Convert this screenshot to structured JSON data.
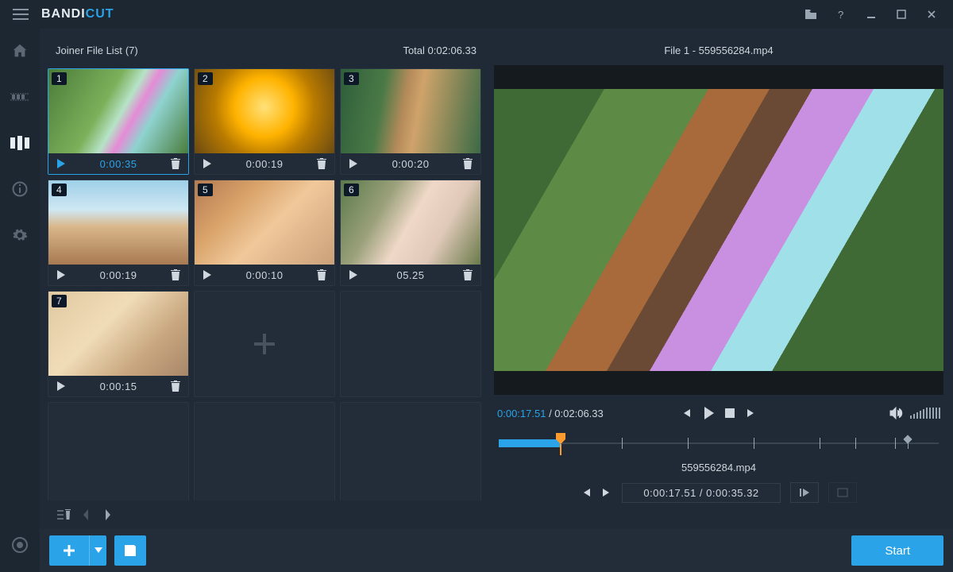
{
  "brand": {
    "bandi": "BANDI",
    "cut": "CUT"
  },
  "list": {
    "title": "Joiner File List",
    "count": "(7)",
    "total_label": "Total",
    "total_time": "0:02:06.33"
  },
  "clips": [
    {
      "n": "1",
      "dur": "0:00:35",
      "selected": true
    },
    {
      "n": "2",
      "dur": "0:00:19"
    },
    {
      "n": "3",
      "dur": "0:00:20"
    },
    {
      "n": "4",
      "dur": "0:00:19"
    },
    {
      "n": "5",
      "dur": "0:00:10"
    },
    {
      "n": "6",
      "dur": "05.25"
    },
    {
      "n": "7",
      "dur": "0:00:15"
    }
  ],
  "preview": {
    "title": "File 1 - 559556284.mp4",
    "time_now": "0:00:17.51",
    "time_total": "0:02:06.33",
    "segment_file": "559556284.mp4",
    "segment_range": "0:00:17.51 / 0:00:35.32"
  },
  "timeline": {
    "fill_pct": 14,
    "handle_pct": 14,
    "marks_pct": [
      28,
      43,
      58,
      73,
      81,
      90,
      93
    ],
    "diamond_pct": 93
  },
  "bottom": {
    "start": "Start"
  }
}
